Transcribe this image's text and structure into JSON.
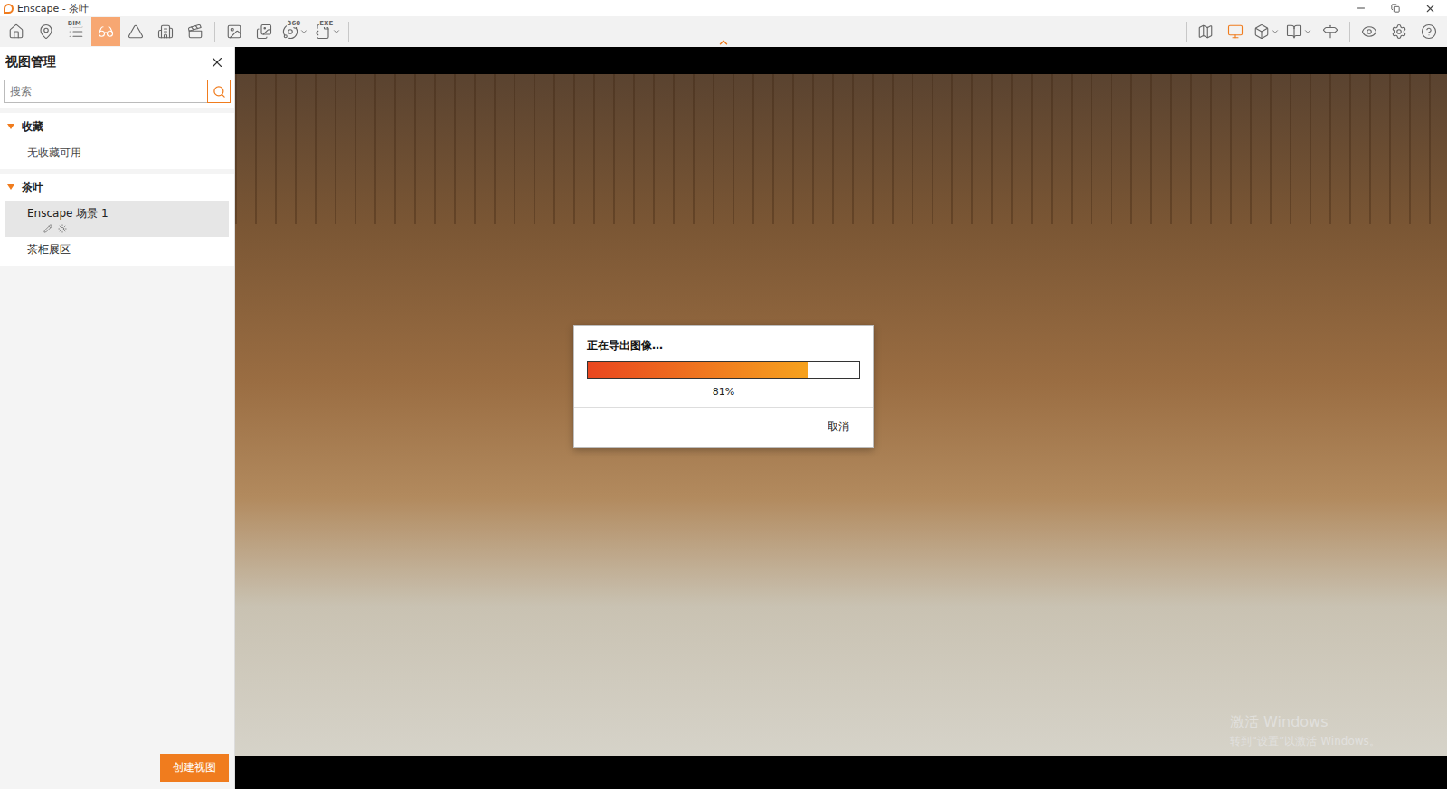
{
  "window": {
    "title": "Enscape - 茶叶"
  },
  "toolbar": {
    "left": [
      {
        "label": "",
        "selected": false,
        "highlighted": false,
        "dropdown": false
      },
      {
        "label": "",
        "selected": false,
        "highlighted": false,
        "dropdown": false
      },
      {
        "label": "BIM",
        "selected": false,
        "highlighted": false,
        "dropdown": false
      },
      {
        "label": "",
        "selected": true,
        "highlighted": false,
        "dropdown": false
      },
      {
        "label": "",
        "selected": false,
        "highlighted": false,
        "dropdown": false
      },
      {
        "label": "",
        "selected": false,
        "highlighted": false,
        "dropdown": false
      },
      {
        "label": "",
        "selected": false,
        "highlighted": false,
        "dropdown": false
      },
      {
        "label": "",
        "selected": false,
        "highlighted": false,
        "dropdown": false
      },
      {
        "label": "",
        "selected": false,
        "highlighted": false,
        "dropdown": false
      },
      {
        "label": "360",
        "selected": false,
        "highlighted": false,
        "dropdown": true
      },
      {
        "label": "EXE",
        "selected": false,
        "highlighted": false,
        "dropdown": true
      }
    ],
    "right": [
      {
        "label": "",
        "selected": false,
        "highlighted": false,
        "dropdown": false
      },
      {
        "label": "",
        "selected": false,
        "highlighted": true,
        "dropdown": false
      },
      {
        "label": "",
        "selected": false,
        "highlighted": false,
        "dropdown": true
      },
      {
        "label": "",
        "selected": false,
        "highlighted": false,
        "dropdown": true
      },
      {
        "label": "",
        "selected": false,
        "highlighted": false,
        "dropdown": false
      },
      {
        "label": "",
        "selected": false,
        "highlighted": false,
        "dropdown": false
      },
      {
        "label": "",
        "selected": false,
        "highlighted": false,
        "dropdown": false
      },
      {
        "label": "",
        "selected": false,
        "highlighted": false,
        "dropdown": false
      }
    ]
  },
  "panel": {
    "title": "视图管理",
    "search": {
      "placeholder": "搜索"
    },
    "groups": [
      {
        "name": "收藏",
        "expanded": true,
        "items": [
          {
            "label": "无收藏可用",
            "kind": "empty",
            "selected": false
          }
        ]
      },
      {
        "name": "茶叶",
        "expanded": true,
        "items": [
          {
            "label": "Enscape 场景 1",
            "kind": "view",
            "selected": true
          },
          {
            "label": "茶柜展区",
            "kind": "view",
            "selected": false
          }
        ]
      }
    ],
    "create_button": "创建视图"
  },
  "dialog": {
    "title": "正在导出图像…",
    "level": 0.81,
    "reading": "81%",
    "cancel": "取消"
  },
  "os_watermark": {
    "title": "激活 Windows",
    "subtitle": "转到“设置”以激活 Windows。"
  }
}
